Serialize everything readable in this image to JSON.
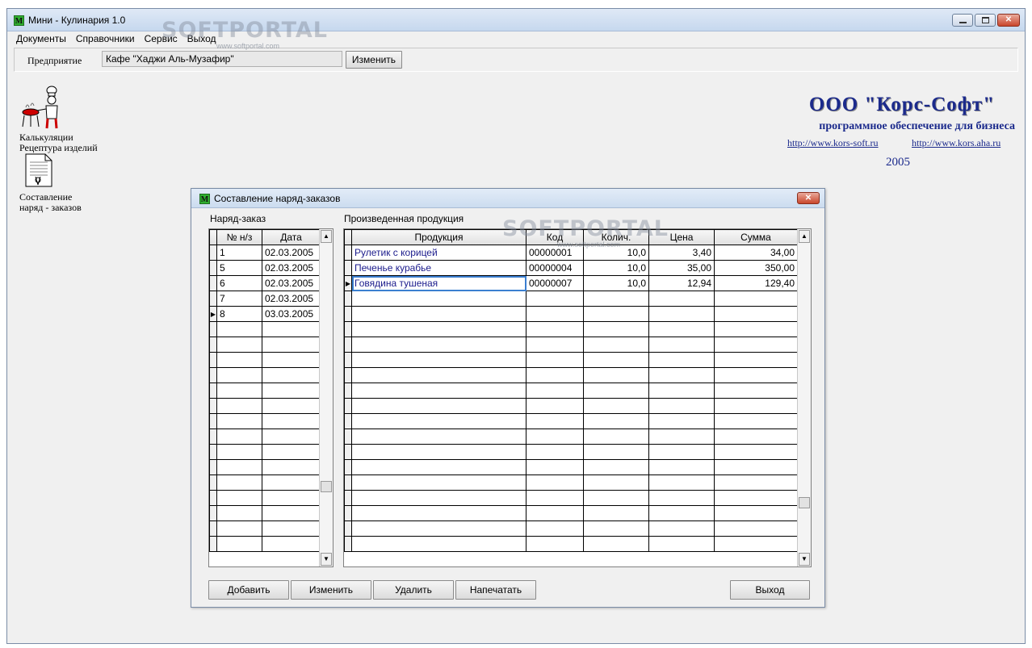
{
  "window": {
    "icon": "M",
    "title": "Мини - Кулинария 1.0",
    "controls": {
      "minimize": "minimize-icon",
      "maximize": "maximize-icon",
      "close": "close-icon"
    }
  },
  "menu": [
    {
      "label": "Документы"
    },
    {
      "label": "Справочники"
    },
    {
      "label": "Сервис"
    },
    {
      "label": "Выход"
    }
  ],
  "enterprise": {
    "label": "Предприятие",
    "value": "Кафе \"Хаджи Аль-Музафир\"",
    "change_button": "Изменить"
  },
  "watermark": {
    "text": "SOFTPORTAL",
    "sub": "www.softportal.com"
  },
  "desktop_icons": [
    {
      "icon": "chef-icon",
      "label": "Калькуляции\nРецептура изделий"
    },
    {
      "icon": "document-icon",
      "label": "Составление\nнаряд - заказов"
    }
  ],
  "company": {
    "name": "ООО \"Корс-Софт\"",
    "tagline": "программное обеспечение для бизнеса",
    "links": [
      "http://www.kors-soft.ru",
      "http://www.kors.aha.ru"
    ],
    "year": "2005"
  },
  "dialog": {
    "icon": "M",
    "title": "Составление наряд-заказов",
    "orders": {
      "label": "Наряд-заказ",
      "columns": [
        "№ н/з",
        "Дата"
      ],
      "rows": [
        {
          "num": "1",
          "date": "02.03.2005"
        },
        {
          "num": "5",
          "date": "02.03.2005"
        },
        {
          "num": "6",
          "date": "02.03.2005"
        },
        {
          "num": "7",
          "date": "02.03.2005"
        },
        {
          "num": "8",
          "date": "03.03.2005"
        }
      ],
      "current_row": 4
    },
    "products": {
      "label": "Произведенная продукция",
      "columns": [
        "Продукция",
        "Код",
        "Колич.",
        "Цена",
        "Сумма"
      ],
      "rows": [
        {
          "name": "Рулетик с корицей",
          "code": "00000001",
          "qty": "10,0",
          "price": "3,40",
          "sum": "34,00"
        },
        {
          "name": "Печенье курабье",
          "code": "00000004",
          "qty": "10,0",
          "price": "35,00",
          "sum": "350,00"
        },
        {
          "name": "Говядина тушеная",
          "code": "00000007",
          "qty": "10,0",
          "price": "12,94",
          "sum": "129,40"
        }
      ],
      "current_row": 2
    },
    "buttons": {
      "add": "Добавить",
      "edit": "Изменить",
      "delete": "Удалить",
      "print": "Напечатать",
      "exit": "Выход"
    }
  }
}
